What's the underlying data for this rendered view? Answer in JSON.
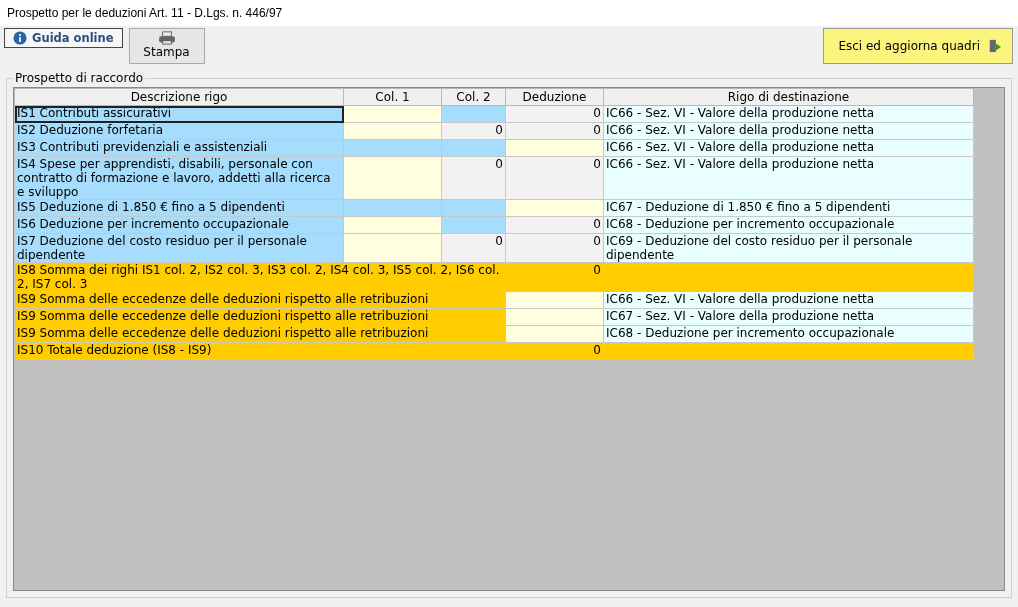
{
  "window": {
    "title": "Prospetto per le deduzioni Art. 11 - D.Lgs. n. 446/97"
  },
  "toolbar": {
    "help_button": "Guida online",
    "print_button": "Stampa",
    "exit_button": "Esci ed aggiorna quadri"
  },
  "panel": {
    "title": "Prospetto di raccordo"
  },
  "table": {
    "columns": [
      "Descrizione rigo",
      "Col. 1",
      "Col. 2",
      "Deduzione",
      "Rigo di destinazione"
    ],
    "rows": [
      {
        "kind": "detail",
        "selected": true,
        "description": "IS1 Contributi assicurativi",
        "col1": {
          "kind": "input"
        },
        "col2": {
          "kind": "na"
        },
        "deduzione": {
          "kind": "calc",
          "value": "0"
        },
        "destination": "IC66 - Sez. VI - Valore della produzione netta"
      },
      {
        "kind": "detail",
        "selected": false,
        "description": "IS2 Deduzione forfetaria",
        "col1": {
          "kind": "input"
        },
        "col2": {
          "kind": "calc",
          "value": "0"
        },
        "deduzione": {
          "kind": "calc",
          "value": "0"
        },
        "destination": "IC66 - Sez. VI - Valore della produzione netta"
      },
      {
        "kind": "detail",
        "selected": false,
        "description": "IS3 Contributi previdenziali e assistenziali",
        "col1": {
          "kind": "na"
        },
        "col2": {
          "kind": "na"
        },
        "deduzione": {
          "kind": "input"
        },
        "destination": "IC66 - Sez. VI - Valore della produzione netta"
      },
      {
        "kind": "detail",
        "selected": false,
        "description": "IS4 Spese per apprendisti, disabili, personale con contratto di formazione e lavoro, addetti alla ricerca e sviluppo",
        "col1": {
          "kind": "input"
        },
        "col2": {
          "kind": "calc",
          "value": "0"
        },
        "deduzione": {
          "kind": "calc",
          "value": "0"
        },
        "destination": "IC66 - Sez. VI - Valore della produzione netta"
      },
      {
        "kind": "detail",
        "selected": false,
        "description": "IS5 Deduzione di 1.850 € fino a 5 dipendenti",
        "col1": {
          "kind": "na"
        },
        "col2": {
          "kind": "na"
        },
        "deduzione": {
          "kind": "input"
        },
        "destination": "IC67 - Deduzione di 1.850 € fino a 5 dipendenti"
      },
      {
        "kind": "detail",
        "selected": false,
        "description": "IS6 Deduzione per incremento occupazionale",
        "col1": {
          "kind": "input"
        },
        "col2": {
          "kind": "na"
        },
        "deduzione": {
          "kind": "calc",
          "value": "0"
        },
        "destination": "IC68 - Deduzione per incremento occupazionale"
      },
      {
        "kind": "detail",
        "selected": false,
        "description": "IS7 Deduzione del costo residuo per il personale dipendente",
        "col1": {
          "kind": "input"
        },
        "col2": {
          "kind": "calc",
          "value": "0"
        },
        "deduzione": {
          "kind": "calc",
          "value": "0"
        },
        "destination": "IC69 - Deduzione del costo residuo per il personale dipendente"
      },
      {
        "kind": "total",
        "selected": false,
        "description": "IS8 Somma dei righi IS1 col. 2, IS2 col. 3, IS3 col. 2, IS4 col. 3, IS5 col. 2, IS6 col. 2, IS7 col. 3",
        "deduzione": {
          "kind": "total",
          "value": "0"
        }
      },
      {
        "kind": "total",
        "selected": false,
        "description": "IS9 Somma delle eccedenze delle deduzioni rispetto alle retribuzioni",
        "deduzione": {
          "kind": "input"
        },
        "destination": "IC66 - Sez. VI - Valore della produzione netta"
      },
      {
        "kind": "total",
        "selected": false,
        "description": "IS9 Somma delle eccedenze delle deduzioni rispetto alle retribuzioni",
        "deduzione": {
          "kind": "input"
        },
        "destination": "IC67 - Sez. VI - Valore della produzione netta"
      },
      {
        "kind": "total",
        "selected": false,
        "description": "IS9 Somma delle eccedenze delle deduzioni rispetto alle retribuzioni",
        "deduzione": {
          "kind": "input"
        },
        "destination": "IC68 - Deduzione per incremento occupazionale"
      },
      {
        "kind": "total",
        "selected": false,
        "description": "IS10 Totale deduzione (IS8 - IS9)",
        "deduzione": {
          "kind": "total",
          "value": "0"
        }
      }
    ]
  }
}
